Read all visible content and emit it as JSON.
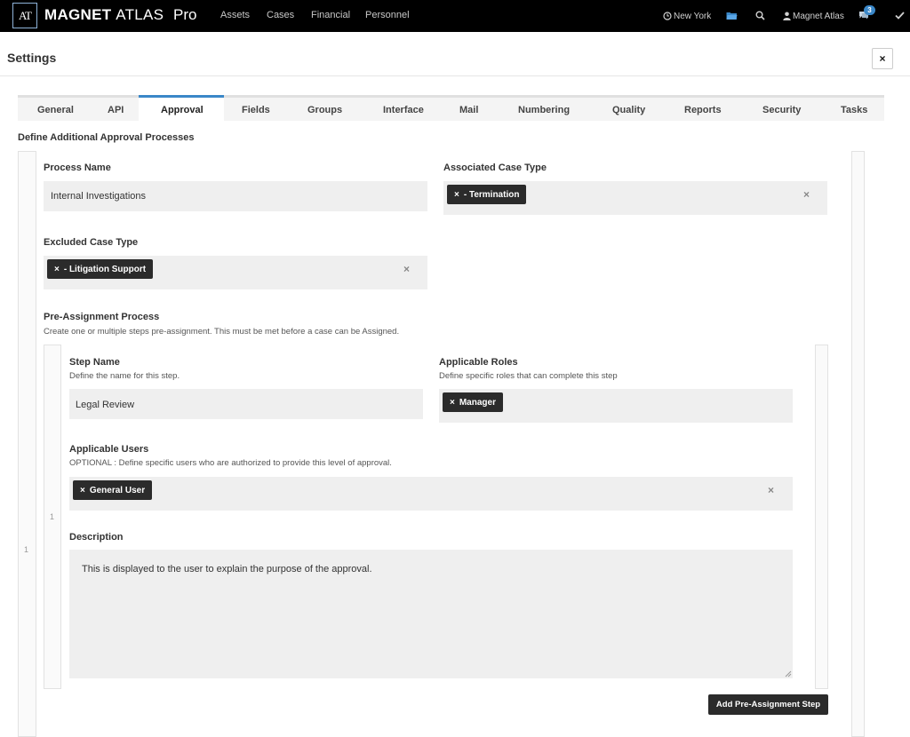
{
  "app": {
    "logo_text": "AT",
    "brand_primary": "MAGNET",
    "brand_secondary": "ATLAS",
    "brand_edition": "Pro",
    "nav": [
      "Assets",
      "Cases",
      "Financial",
      "Personnel"
    ],
    "location": "New York",
    "user": "Magnet Atlas",
    "notification_count": "3",
    "icons": [
      "clock-icon",
      "folder-icon",
      "search-icon",
      "user-icon",
      "chat-icon",
      "check-icon"
    ]
  },
  "page": {
    "title": "Settings",
    "close_label": "×"
  },
  "tabs": {
    "items": [
      "General",
      "API",
      "Approval",
      "Fields",
      "Groups",
      "Interface",
      "Mail",
      "Numbering",
      "Quality",
      "Reports",
      "Security",
      "Tasks"
    ],
    "active": "Approval"
  },
  "section": {
    "title": "Define Additional Approval Processes",
    "row_number": "1"
  },
  "process": {
    "name_label": "Process Name",
    "name_value": "Internal Investigations",
    "associated_label": "Associated Case Type",
    "associated_tags": [
      "- Termination"
    ],
    "excluded_label": "Excluded Case Type",
    "excluded_tags": [
      "- Litigation Support"
    ],
    "tag_remove": "×",
    "clear_label": "×"
  },
  "pre_assignment": {
    "title": "Pre-Assignment Process",
    "hint": "Create one or multiple steps pre-assignment. This must be met before a case can be Assigned.",
    "row_number": "1",
    "step_name_label": "Step Name",
    "step_name_hint": "Define the name for this step.",
    "step_name_value": "Legal Review",
    "roles_label": "Applicable Roles",
    "roles_hint": "Define specific roles that can complete this step",
    "roles_tags": [
      "Manager"
    ],
    "users_label": "Applicable Users",
    "users_hint": "OPTIONAL : Define specific users who are authorized to provide this level of approval.",
    "users_tags": [
      "General User"
    ],
    "description_label": "Description",
    "description_value": "This is displayed to the user to explain the purpose of the approval.",
    "add_button": "Add Pre-Assignment Step"
  },
  "colors": {
    "topbar": "#000000",
    "tab_accent": "#3a87c8",
    "tag_bg": "#2b2b2b",
    "field_bg": "#efefef"
  }
}
